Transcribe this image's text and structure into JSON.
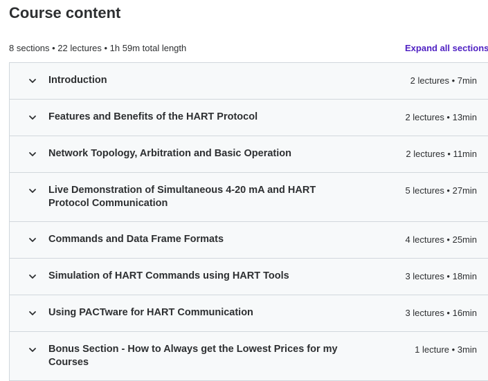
{
  "header": {
    "title": "Course content",
    "stats": "8 sections • 22 lectures • 1h 59m total length",
    "expand_label": "Expand all sections"
  },
  "sections": [
    {
      "title": "Introduction",
      "meta": "2 lectures • 7min"
    },
    {
      "title": "Features and Benefits of the HART Protocol",
      "meta": "2 lectures • 13min"
    },
    {
      "title": "Network Topology, Arbitration and Basic Operation",
      "meta": "2 lectures • 11min"
    },
    {
      "title": "Live Demonstration of Simultaneous 4-20 mA and HART Protocol Communication",
      "meta": "5 lectures • 27min"
    },
    {
      "title": "Commands and Data Frame Formats",
      "meta": "4 lectures • 25min"
    },
    {
      "title": "Simulation of HART Commands using HART Tools",
      "meta": "3 lectures • 18min"
    },
    {
      "title": "Using PACTware for HART Communication",
      "meta": "3 lectures • 16min"
    },
    {
      "title": "Bonus Section - How to Always get the Lowest Prices for my Courses",
      "meta": "1 lecture • 3min"
    }
  ],
  "icons": {
    "section_toggle": "chevron-down-icon"
  },
  "colors": {
    "accent": "#5022c3",
    "row_bg": "#f7f9fa",
    "border": "#d1d7dc",
    "text": "#2d2f31"
  }
}
